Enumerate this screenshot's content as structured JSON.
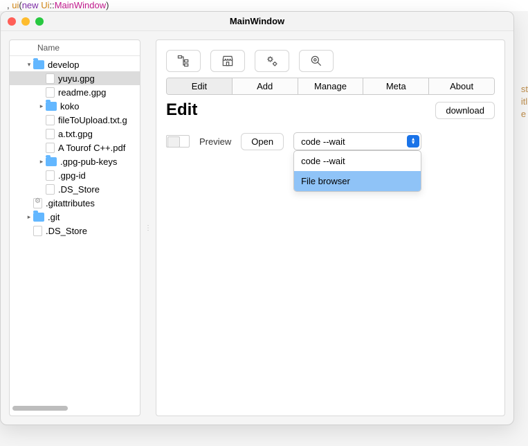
{
  "code_fragment": {
    "pre": ", ",
    "fn": "ui",
    "paren_open": "(",
    "kw": "new",
    "sp": " ",
    "ns": "Ui",
    "colons": "::",
    "cls": "MainWindow",
    "paren_close": ")"
  },
  "window": {
    "title": "MainWindow"
  },
  "tree": {
    "header": "Name",
    "items": [
      {
        "type": "folder",
        "label": "develop",
        "expanded": true,
        "indent": 1
      },
      {
        "type": "file",
        "label": "yuyu.gpg",
        "selected": true,
        "indent": 2
      },
      {
        "type": "file",
        "label": "readme.gpg",
        "indent": 2
      },
      {
        "type": "folder",
        "label": "koko",
        "expanded": false,
        "indent": 2
      },
      {
        "type": "file",
        "label": "fileToUpload.txt.g",
        "indent": 2
      },
      {
        "type": "file",
        "label": "a.txt.gpg",
        "indent": 2
      },
      {
        "type": "file",
        "label": "A Tourof C++.pdf",
        "indent": 2
      },
      {
        "type": "folder",
        "label": ".gpg-pub-keys",
        "expanded": false,
        "indent": 2
      },
      {
        "type": "file",
        "label": ".gpg-id",
        "indent": 2
      },
      {
        "type": "file",
        "label": ".DS_Store",
        "indent": 2
      },
      {
        "type": "file",
        "label": ".gitattributes",
        "gear": true,
        "indent": 1
      },
      {
        "type": "folder",
        "label": ".git",
        "expanded": false,
        "indent": 1
      },
      {
        "type": "file",
        "label": ".DS_Store",
        "indent": 1
      }
    ]
  },
  "toolbar_icons": [
    "tree-icon",
    "store-icon",
    "gears-icon",
    "zoom-icon"
  ],
  "tabs": [
    "Edit",
    "Add",
    "Manage",
    "Meta",
    "About"
  ],
  "active_tab": "Edit",
  "page": {
    "heading": "Edit",
    "download_btn": "download",
    "preview_label": "Preview",
    "open_btn": "Open"
  },
  "select": {
    "value": "code --wait",
    "options": [
      "code --wait",
      "File browser"
    ],
    "highlighted": "File browser"
  },
  "right_edge": [
    "st",
    "itl",
    "",
    "",
    "",
    "",
    "",
    "e "
  ]
}
